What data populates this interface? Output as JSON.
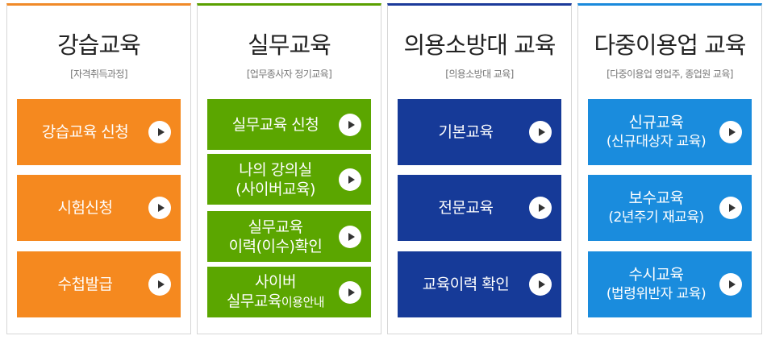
{
  "panels": [
    {
      "title": "강습교육",
      "subtitle": "[자격취득과정]",
      "color": "#f5891f",
      "buttons": [
        {
          "label": "강습교육 신청"
        },
        {
          "label": "시험신청"
        },
        {
          "label": "수첩발급"
        }
      ]
    },
    {
      "title": "실무교육",
      "subtitle": "[업무종사자 정기교육]",
      "color": "#5ba600",
      "buttons": [
        {
          "label": "실무교육 신청"
        },
        {
          "line1": "나의 강의실",
          "line2": "(사이버교육)"
        },
        {
          "line1": "실무교육",
          "line2": "이력(이수)확인"
        },
        {
          "line1": "사이버",
          "line2a": "실무교육",
          "line2b": "이용안내"
        }
      ]
    },
    {
      "title": "의용소방대 교육",
      "subtitle": "[의용소방대 교육]",
      "color": "#163a98",
      "buttons": [
        {
          "label": "기본교육"
        },
        {
          "label": "전문교육"
        },
        {
          "label": "교육이력 확인"
        }
      ]
    },
    {
      "title": "다중이용업 교육",
      "subtitle": "[다중이용업 영업주, 종업원 교육]",
      "color": "#1a8cdd",
      "buttons": [
        {
          "line1": "신규교육",
          "line2": "(신규대상자 교육)"
        },
        {
          "line1": "보수교육",
          "line2": "(2년주기 재교육)"
        },
        {
          "line1": "수시교육",
          "line2": "(법령위반자 교육)"
        }
      ]
    }
  ]
}
